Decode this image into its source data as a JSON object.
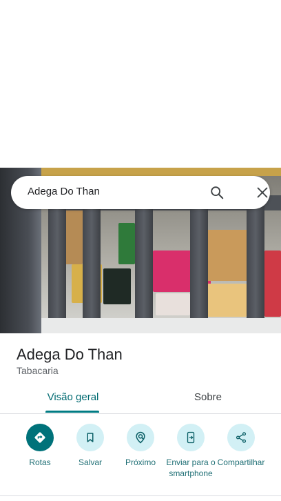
{
  "search": {
    "query": "Adega Do Than"
  },
  "place": {
    "name": "Adega Do Than",
    "category": "Tabacaria"
  },
  "tabs": [
    {
      "label": "Visão geral",
      "active": true
    },
    {
      "label": "Sobre",
      "active": false
    }
  ],
  "actions": [
    {
      "label": "Rotas",
      "icon": "directions-icon"
    },
    {
      "label": "Salvar",
      "icon": "bookmark-icon"
    },
    {
      "label": "Próximo",
      "icon": "nearby-icon"
    },
    {
      "label": "Enviar para o smartphone",
      "icon": "send-to-phone-icon"
    },
    {
      "label": "Compartilhar",
      "icon": "share-icon"
    }
  ],
  "colors": {
    "accent": "#007b83",
    "accent_light": "#d2f0f5",
    "text_primary": "#202124",
    "text_secondary": "#5f6368"
  }
}
